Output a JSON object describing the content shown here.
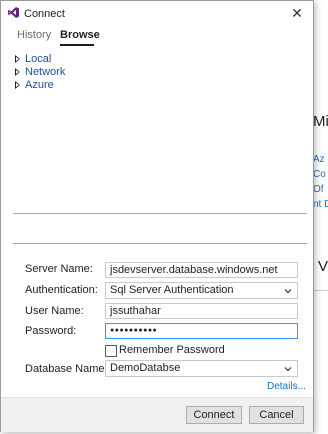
{
  "background_app": {
    "heading": "Mi",
    "links": [
      "Az",
      "Co",
      "Of",
      "nt D"
    ],
    "lower_heading": "V"
  },
  "dialog": {
    "title": "Connect",
    "close_glyph": "✕",
    "tabs": [
      {
        "label": "History",
        "selected": false
      },
      {
        "label": "Browse",
        "selected": true
      }
    ],
    "tree": [
      {
        "label": "Local"
      },
      {
        "label": "Network"
      },
      {
        "label": "Azure"
      }
    ],
    "form": {
      "server_name": {
        "label": "Server Name:",
        "value": "jsdevserver.database.windows.net"
      },
      "authentication": {
        "label": "Authentication:",
        "value": "Sql Server Authentication"
      },
      "user_name": {
        "label": "User Name:",
        "value": "jssuthahar"
      },
      "password": {
        "label": "Password:",
        "value": "●●●●●●●●●●"
      },
      "remember_password": {
        "label": "Remember Password",
        "checked": false
      },
      "database_name": {
        "label": "Database Name:",
        "value": "DemoDatabse"
      },
      "details_link": "Details..."
    },
    "buttons": {
      "connect": "Connect",
      "cancel": "Cancel"
    }
  },
  "colors": {
    "accent": "#3399ff",
    "link": "#1e4f99",
    "app_icon": "#68217a"
  }
}
